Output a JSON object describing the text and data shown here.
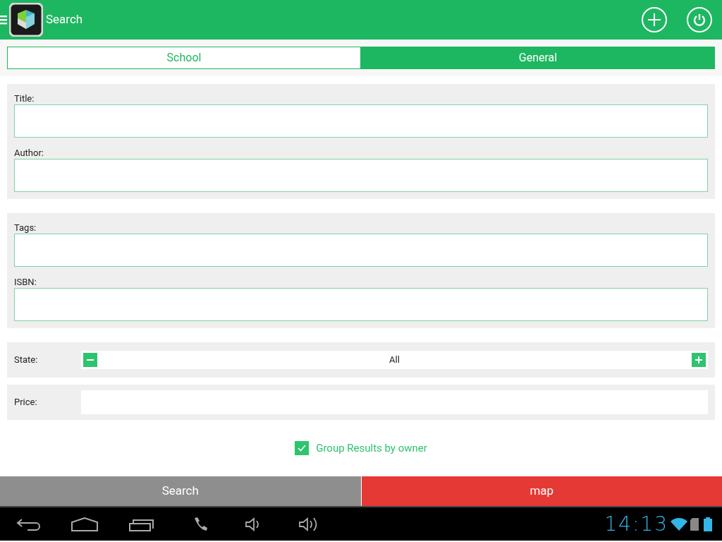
{
  "app_bar": {
    "title": "Search"
  },
  "tabs": [
    {
      "label": "School",
      "selected": false
    },
    {
      "label": "General",
      "selected": true
    }
  ],
  "sections": [
    {
      "fields": [
        {
          "label": "Title:"
        },
        {
          "label": "Author:"
        }
      ]
    },
    {
      "fields": [
        {
          "label": "Tags:"
        },
        {
          "label": "ISBN:"
        }
      ]
    }
  ],
  "state": {
    "label": "State:",
    "value": "All"
  },
  "price": {
    "label": "Price:"
  },
  "group_by_owner": {
    "label": "Group Results by owner",
    "checked": true
  },
  "actions": [
    {
      "label": "Search",
      "color": "#8e8e8e"
    },
    {
      "label": "map",
      "color": "#e53935"
    }
  ],
  "status_bar": {
    "time": "14:13"
  }
}
